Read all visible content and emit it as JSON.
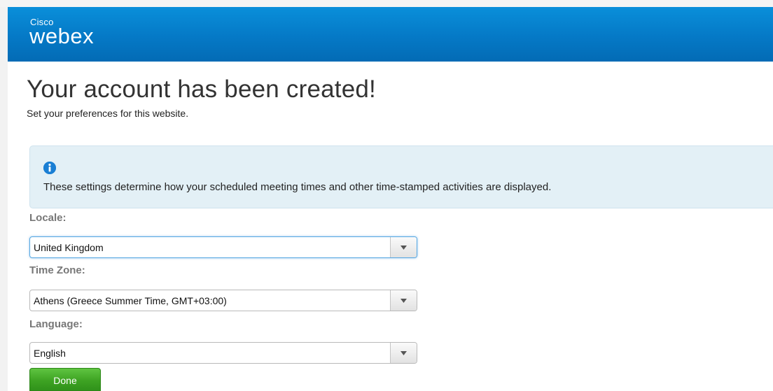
{
  "brand": {
    "company": "Cisco",
    "product": "webex",
    "header_color": "#0579c6"
  },
  "page": {
    "title": "Your account has been created!",
    "subtitle": "Set your preferences for this website."
  },
  "info": {
    "icon": "info-icon",
    "text": "These settings determine how your scheduled meeting times and other time-stamped activities are displayed."
  },
  "form": {
    "locale": {
      "label": "Locale:",
      "value": "United Kingdom"
    },
    "timezone": {
      "label": "Time Zone:",
      "value": "Athens (Greece Summer Time, GMT+03:00)"
    },
    "language": {
      "label": "Language:",
      "value": "English"
    },
    "done_label": "Done",
    "done_color": "#3ea323"
  }
}
